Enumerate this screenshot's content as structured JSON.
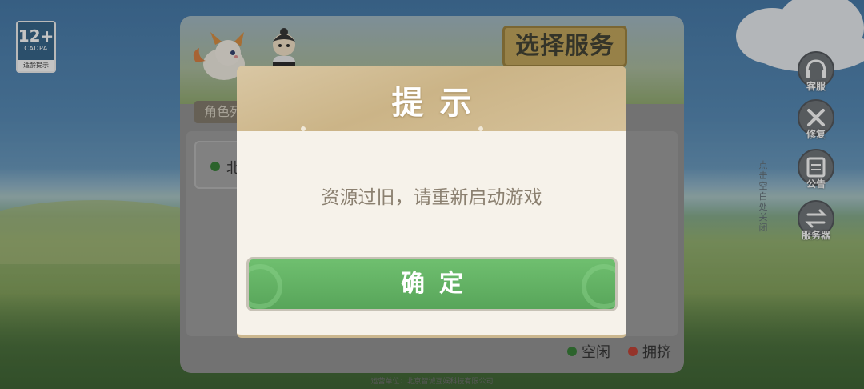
{
  "age_badge": {
    "age": "12+",
    "org": "CADPA",
    "tip": "适龄提示"
  },
  "server_panel": {
    "title": "选择服务器",
    "role_tab": "角色列",
    "server_item": {
      "name": "北"
    },
    "legend": [
      {
        "label": "空闲",
        "color": "#2f7a2f"
      },
      {
        "label": "拥挤",
        "color": "#c0392b"
      }
    ]
  },
  "side_buttons": [
    {
      "label": "客服",
      "icon": "headset-icon"
    },
    {
      "label": "修复",
      "icon": "wrench-icon"
    },
    {
      "label": "公告",
      "icon": "notice-icon"
    },
    {
      "label": "服务器",
      "icon": "switch-icon"
    }
  ],
  "tap_hint": "点击空白处关闭",
  "operator": "运营单位：北京智诚互娱科技有限公司",
  "dialog": {
    "title": "提示",
    "message": "资源过旧，请重新启动游戏",
    "ok_label": "确定"
  },
  "colors": {
    "ok_button": "#5cab5e",
    "dialog_header": "#cbb487",
    "dialog_body": "#f6f2ea"
  }
}
